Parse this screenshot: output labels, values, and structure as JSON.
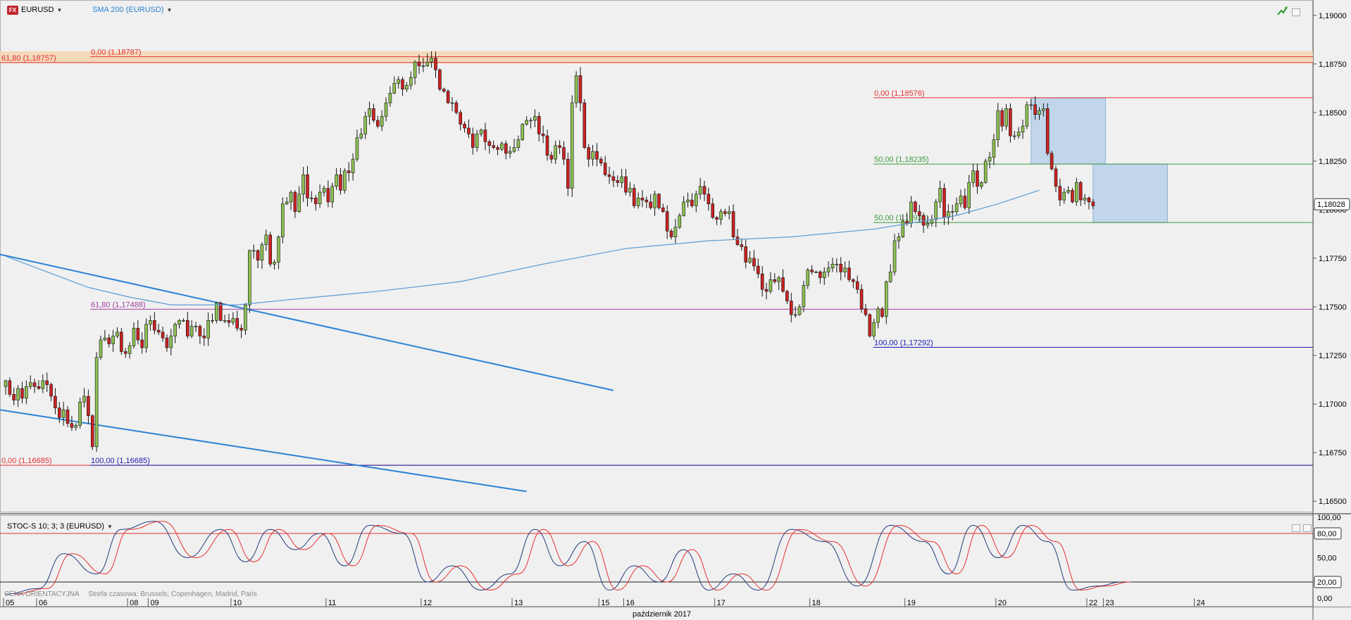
{
  "header": {
    "symbol": "EURUSD",
    "symbol_icon": "FX",
    "indicator": "SMA 200 (EURUSD)"
  },
  "lower_pane": {
    "indicator": "STOC-S 10; 3; 3 (EURUSD)",
    "footer_price_type": "CENA ORIENTACYJNA",
    "footer_timezone": "Strefa czasowa: Brussels, Copenhagen, Madrid, Paris"
  },
  "colors": {
    "bull": "#8cc152",
    "bear": "#cc2222",
    "sma": "#5b9bd5",
    "trendline": "#2b83d4",
    "fib_red": "#e53030",
    "fib_green": "#3a9a3a",
    "fib_purple": "#a040a0",
    "fib_blue": "#1a1ab0",
    "stoch_k": "#1f3b7a",
    "stoch_d": "#e53030",
    "rect_fill": "#a8c8e8",
    "band_fill": "#f5d6b2"
  },
  "icons": {
    "tool": "trend-tool-icon",
    "dropdown": "chevron-down-icon"
  },
  "chart_data": {
    "type": "candlestick",
    "symbol": "EURUSD",
    "ylim": [
      1.1645,
      1.1905
    ],
    "price_ticks": [
      "1,19000",
      "1,18750",
      "1,18500",
      "1,18250",
      "1,18000",
      "1,17750",
      "1,17500",
      "1,17250",
      "1,17000",
      "1,16750",
      "1,16500"
    ],
    "price_tick_values": [
      1.19,
      1.1875,
      1.185,
      1.1825,
      1.18,
      1.1775,
      1.175,
      1.1725,
      1.17,
      1.1675,
      1.165
    ],
    "last_price_label": "1,18028",
    "last_price": 1.18028,
    "date_ticks": [
      {
        "label": "05",
        "bar": 0
      },
      {
        "label": "06",
        "bar": 8
      },
      {
        "label": "08",
        "bar": 30
      },
      {
        "label": "09",
        "bar": 35
      },
      {
        "label": "10",
        "bar": 55
      },
      {
        "label": "11",
        "bar": 78
      },
      {
        "label": "12",
        "bar": 101
      },
      {
        "label": "13",
        "bar": 123
      },
      {
        "label": "15",
        "bar": 144
      },
      {
        "label": "16",
        "bar": 150
      },
      {
        "label": "17",
        "bar": 172
      },
      {
        "label": "18",
        "bar": 195
      },
      {
        "label": "19",
        "bar": 218
      },
      {
        "label": "20",
        "bar": 240
      },
      {
        "label": "22",
        "bar": 262
      },
      {
        "label": "23",
        "bar": 266
      },
      {
        "label": "24",
        "bar": 288
      }
    ],
    "month_label": "październik 2017",
    "series": [
      {
        "name": "EURUSD",
        "closes": [
          1.1712,
          1.1705,
          1.1702,
          1.1708,
          1.1703,
          1.1709,
          1.1711,
          1.1709,
          1.1708,
          1.1712,
          1.171,
          1.1704,
          1.1698,
          1.1693,
          1.1697,
          1.169,
          1.1688,
          1.1689,
          1.1701,
          1.1704,
          1.1694,
          1.1678,
          1.1724,
          1.1733,
          1.1734,
          1.1731,
          1.1735,
          1.1737,
          1.1727,
          1.1726,
          1.173,
          1.1739,
          1.1733,
          1.1729,
          1.1741,
          1.1743,
          1.1738,
          1.1737,
          1.1734,
          1.1729,
          1.1735,
          1.1741,
          1.1743,
          1.1743,
          1.1735,
          1.174,
          1.174,
          1.1735,
          1.1734,
          1.1743,
          1.1743,
          1.1752,
          1.1743,
          1.1743,
          1.1742,
          1.1744,
          1.1739,
          1.1738,
          1.1751,
          1.1779,
          1.1779,
          1.1774,
          1.1782,
          1.1787,
          1.1772,
          1.1773,
          1.1786,
          1.1803,
          1.1804,
          1.1809,
          1.1799,
          1.1808,
          1.1818,
          1.1806,
          1.1806,
          1.1803,
          1.1809,
          1.1811,
          1.1804,
          1.1812,
          1.1818,
          1.181,
          1.182,
          1.1819,
          1.1826,
          1.1837,
          1.1839,
          1.1848,
          1.1852,
          1.1846,
          1.1843,
          1.1848,
          1.1855,
          1.186,
          1.1865,
          1.1867,
          1.1862,
          1.1864,
          1.1868,
          1.1876,
          1.1874,
          1.1874,
          1.1876,
          1.1878,
          1.1872,
          1.1862,
          1.1861,
          1.1855,
          1.1855,
          1.185,
          1.1844,
          1.1842,
          1.1839,
          1.1832,
          1.1839,
          1.1841,
          1.1835,
          1.1833,
          1.1832,
          1.1831,
          1.1834,
          1.1829,
          1.183,
          1.1832,
          1.1836,
          1.1844,
          1.1846,
          1.1846,
          1.1848,
          1.1839,
          1.1838,
          1.1828,
          1.1826,
          1.1833,
          1.1832,
          1.1826,
          1.1811,
          1.1855,
          1.1869,
          1.1855,
          1.1832,
          1.1826,
          1.183,
          1.1826,
          1.1824,
          1.1818,
          1.1817,
          1.1815,
          1.1814,
          1.1817,
          1.1809,
          1.1811,
          1.1802,
          1.1806,
          1.1805,
          1.1804,
          1.1801,
          1.1808,
          1.1801,
          1.1799,
          1.1789,
          1.1786,
          1.1791,
          1.1797,
          1.1804,
          1.1805,
          1.1802,
          1.1808,
          1.1812,
          1.1808,
          1.1803,
          1.1796,
          1.1795,
          1.1799,
          1.1798,
          1.1799,
          1.1786,
          1.1782,
          1.1781,
          1.1773,
          1.1775,
          1.1771,
          1.1767,
          1.1759,
          1.1758,
          1.1764,
          1.1763,
          1.1765,
          1.1758,
          1.1753,
          1.1746,
          1.1746,
          1.175,
          1.1761,
          1.1769,
          1.1768,
          1.1768,
          1.1765,
          1.1768,
          1.177,
          1.1772,
          1.1772,
          1.1768,
          1.177,
          1.1764,
          1.1763,
          1.1759,
          1.1749,
          1.1746,
          1.1735,
          1.1742,
          1.1749,
          1.1745,
          1.1763,
          1.1768,
          1.1784,
          1.1786,
          1.1794,
          1.1793,
          1.1804,
          1.1799,
          1.1797,
          1.1792,
          1.1793,
          1.1795,
          1.1804,
          1.1811,
          1.1796,
          1.1799,
          1.1799,
          1.1803,
          1.1807,
          1.1801,
          1.1814,
          1.182,
          1.1812,
          1.1814,
          1.1825,
          1.1827,
          1.1836,
          1.1851,
          1.1843,
          1.1852,
          1.1838,
          1.1838,
          1.184,
          1.1843,
          1.1854,
          1.1854,
          1.1849,
          1.1851,
          1.1852,
          1.1829,
          1.1821,
          1.1812,
          1.1805,
          1.1809,
          1.181,
          1.1804,
          1.1814,
          1.1805,
          1.1806,
          1.1804,
          1.1802
        ]
      },
      {
        "name": "SMA 200 (EURUSD)",
        "from_bar": 56,
        "values": [
          1.175,
          1.1761,
          1.1773,
          1.1778,
          1.1787,
          1.1793,
          1.1797,
          1.1802,
          1.1803,
          1.1806,
          1.1806,
          1.1808,
          1.181
        ]
      }
    ],
    "sma_anchor_bars": [
      0,
      10,
      20,
      30,
      40,
      50,
      56,
      70,
      90,
      110,
      130,
      150,
      170,
      190,
      210,
      230,
      240,
      250
    ],
    "sma_anchor_values": [
      1.1776,
      1.1768,
      1.176,
      1.1755,
      1.1751,
      1.1751,
      1.1751,
      1.1754,
      1.1758,
      1.1763,
      1.1772,
      1.178,
      1.1784,
      1.1786,
      1.179,
      1.1797,
      1.1803,
      1.181
    ],
    "fib_levels": [
      {
        "label": "0,00 (1,18787)",
        "value": 1.18787,
        "color": "fib_red",
        "from_bar": 14
      },
      {
        "label": "61,80 (1,18757)",
        "value": 1.18757,
        "color": "fib_red",
        "from_bar": 0
      },
      {
        "label": "0,00 (1,18576)",
        "value": 1.18576,
        "color": "fib_red",
        "from_bar": 226
      },
      {
        "label": "50,00 (1,18235)",
        "value": 1.18235,
        "color": "fib_green",
        "from_bar": 226
      },
      {
        "label": "50,00 (1,17934)",
        "value": 1.17934,
        "color": "fib_green",
        "from_bar": 226
      },
      {
        "label": "61,80 (1,17488)",
        "value": 1.17488,
        "color": "fib_purple",
        "from_bar": 14
      },
      {
        "label": "100,00 (1,17292)",
        "value": 1.17292,
        "color": "fib_blue",
        "from_bar": 226
      },
      {
        "label": "0,00 (1,16685)",
        "value": 1.16685,
        "color": "fib_red",
        "from_bar": 0
      },
      {
        "label": "100,00 (1,16685)",
        "value": 1.16685,
        "color": "fib_blue",
        "from_bar": 14
      }
    ],
    "trendlines": [
      {
        "from": [
          0,
          1.1777
        ],
        "to": [
          147,
          1.1707
        ]
      },
      {
        "from": [
          0,
          1.1697
        ],
        "to": [
          126,
          1.1655
        ]
      }
    ],
    "rectangles": [
      {
        "from": [
          248,
          1.18576
        ],
        "to": [
          266,
          1.18235
        ]
      },
      {
        "from": [
          263,
          1.18235
        ],
        "to": [
          281,
          1.17934
        ]
      }
    ],
    "stochastic": {
      "label": "STOC-S 10; 3; 3 (EURUSD)",
      "ylim": [
        0,
        100
      ],
      "ticks": [
        "100,00",
        "80,00",
        "50,00",
        "20,00",
        "0,00"
      ],
      "tick_values": [
        100,
        80,
        50,
        20,
        0
      ],
      "levels": [
        80,
        20
      ],
      "k_anchor_bars": [
        0,
        8,
        14,
        22,
        28,
        36,
        44,
        52,
        58,
        64,
        70,
        76,
        82,
        88,
        96,
        102,
        108,
        115,
        122,
        128,
        134,
        140,
        146,
        152,
        158,
        164,
        170,
        176,
        182,
        190,
        198,
        206,
        214,
        222,
        228,
        234,
        240,
        246,
        252,
        258,
        264,
        270
      ],
      "k_anchor_values": [
        5,
        12,
        55,
        30,
        85,
        95,
        50,
        85,
        45,
        85,
        60,
        80,
        40,
        90,
        80,
        20,
        40,
        10,
        30,
        85,
        40,
        70,
        10,
        40,
        20,
        60,
        10,
        30,
        10,
        85,
        70,
        15,
        90,
        70,
        30,
        90,
        50,
        90,
        70,
        10,
        15,
        20
      ]
    }
  }
}
